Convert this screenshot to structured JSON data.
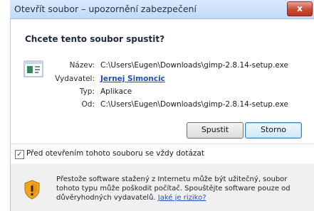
{
  "window": {
    "title": "Otevřít soubor – upozornění zabezpečení",
    "close_label": "x"
  },
  "dialog": {
    "question": "Chcete tento soubor spustit?",
    "fields": {
      "name_label": "Název:",
      "name_value": "C:\\Users\\Eugen\\Downloads\\gimp-2.8.14-setup.exe",
      "publisher_label": "Vydavatel:",
      "publisher_value": "Jernej Simoncic",
      "type_label": "Typ:",
      "type_value": "Aplikace",
      "from_label": "Od:",
      "from_value": "C:\\Users\\Eugen\\Downloads\\gimp-2.8.14-setup.exe"
    },
    "buttons": {
      "run": "Spustit",
      "cancel": "Storno"
    },
    "checkbox": {
      "label": "Před otevřením tohoto souboru se vždy dotázat",
      "checked": true
    },
    "warning": {
      "text": "Přestože software stažený z Internetu může být užitečný, soubor tohoto typu může poškodit počítač. Spouštějte software pouze od důvěryhodných vydavatelů. ",
      "link": "Jaké je riziko?"
    }
  },
  "icons": {
    "file": "application-icon",
    "warning": "security-shield-icon"
  },
  "colors": {
    "titlebar": "#c3daf6",
    "close_button": "#c94a35",
    "link": "#1f51b8",
    "footer": "#f0f0f0"
  }
}
